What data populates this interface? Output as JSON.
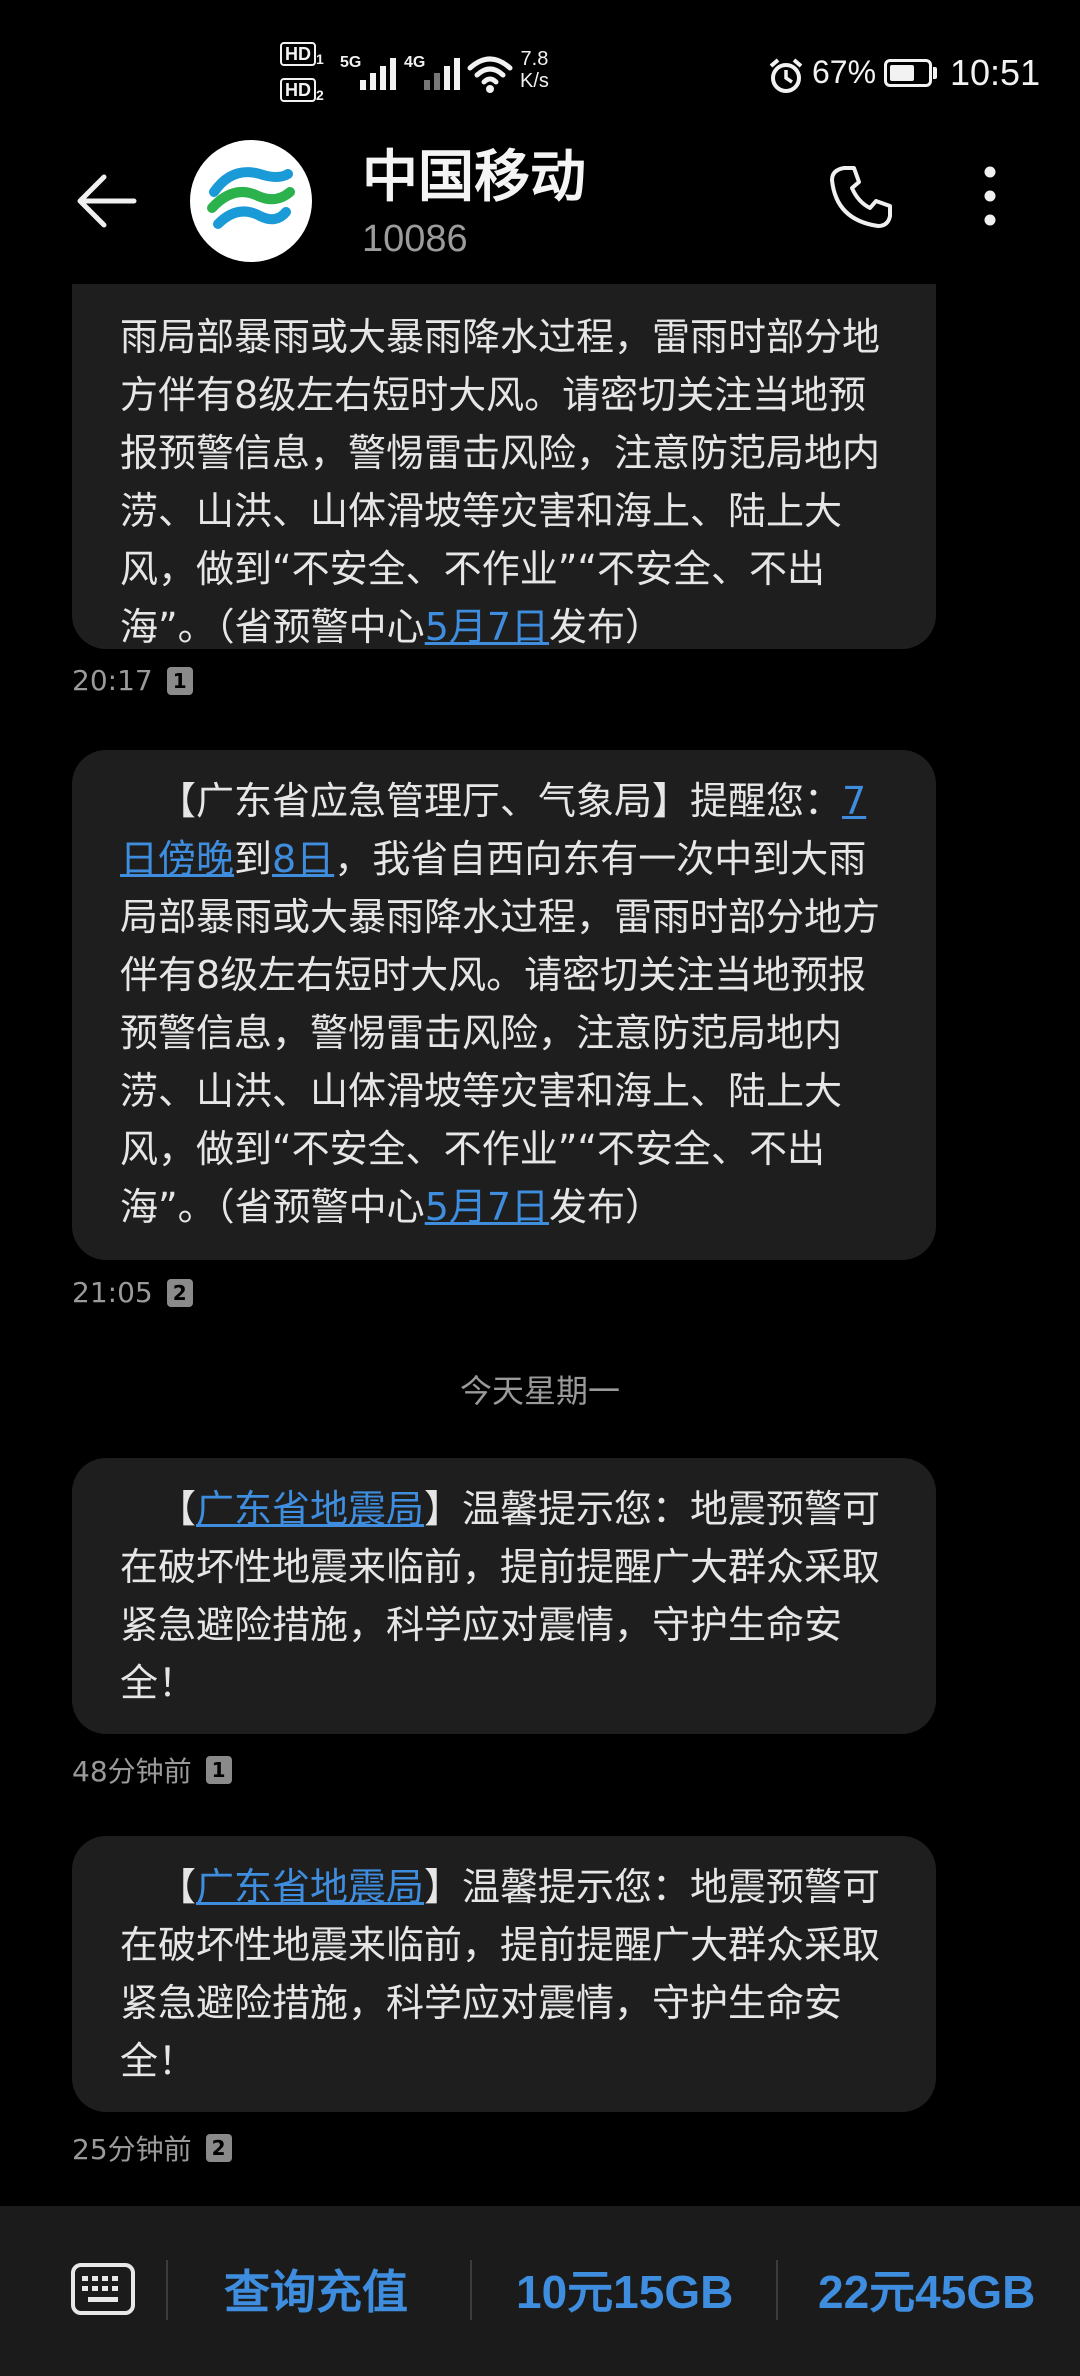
{
  "status_bar": {
    "hd1": "HD",
    "hd1_sub": "1",
    "hd2": "HD",
    "hd2_sub": "2",
    "net1": "5G",
    "net2": "4G",
    "speed_value": "7.8",
    "speed_unit": "K/s",
    "battery": "67%",
    "time": "10:51",
    "battery_level": 0.67
  },
  "header": {
    "title": "中国移动",
    "number": "10086",
    "avatar_icon": "china-mobile-logo",
    "icons": [
      "back-arrow-icon",
      "phone-icon",
      "more-vertical-icon"
    ]
  },
  "messages": [
    {
      "segments": [
        {
          "text": "雨局部暴雨或大暴雨降水过程，雷雨时部分地方伴有8级左右短时大风。请密切关注当地预报预警信息，警惕雷击风险，注意防范局地内涝、山洪、山体滑坡等灾害和海上、陆上大风，做到“不安全、不作业”“不安全、不出海”。（省预警中心"
        },
        {
          "text": "5月7日",
          "link": true
        },
        {
          "text": "发布）"
        }
      ],
      "time": "20:17",
      "sim": "1"
    },
    {
      "segments": [
        {
          "text": "【广东省应急管理厅、气象局】提醒您："
        },
        {
          "text": "7日傍晚",
          "link": true
        },
        {
          "text": "到"
        },
        {
          "text": "8日",
          "link": true
        },
        {
          "text": "，我省自西向东有一次中到大雨局部暴雨或大暴雨降水过程，雷雨时部分地方伴有8级左右短时大风。请密切关注当地预报预警信息，警惕雷击风险，注意防范局地内涝、山洪、山体滑坡等灾害和海上、陆上大风，做到“不安全、不作业”“不安全、不出海”。（省预警中心"
        },
        {
          "text": "5月7日",
          "link": true
        },
        {
          "text": "发布）"
        }
      ],
      "time": "21:05",
      "sim": "2"
    },
    {
      "segments": [
        {
          "text": "【"
        },
        {
          "text": "广东省地震局",
          "link": true
        },
        {
          "text": "】温馨提示您：地震预警可在破坏性地震来临前，提前提醒广大群众采取紧急避险措施，科学应对震情，守护生命安全！"
        }
      ],
      "time": "48分钟前",
      "sim": "1"
    },
    {
      "segments": [
        {
          "text": "【"
        },
        {
          "text": "广东省地震局",
          "link": true
        },
        {
          "text": "】温馨提示您：地震预警可在破坏性地震来临前，提前提醒广大群众采取紧急避险措施，科学应对震情，守护生命安全！"
        }
      ],
      "time": "25分钟前",
      "sim": "2"
    }
  ],
  "day_separator": "今天星期一",
  "bottom_bar": {
    "keyboard_icon": "keyboard-icon",
    "quick_replies": [
      "查询充值",
      "10元15GB",
      "22元45GB"
    ]
  },
  "colors": {
    "background": "#000000",
    "bubble": "#1e1e1e",
    "link": "#3e8dde",
    "bottom_bar": "#1b1b1b"
  }
}
